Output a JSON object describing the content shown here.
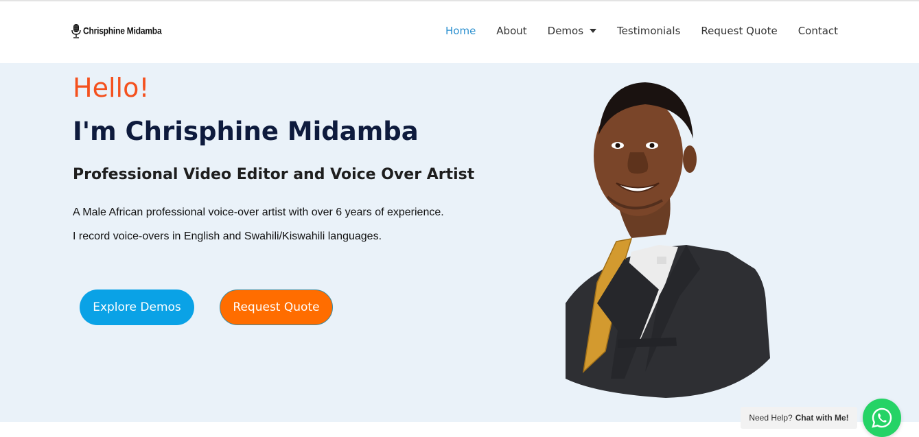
{
  "brand": {
    "name": "Chrisphine Midamba"
  },
  "nav": {
    "items": [
      {
        "label": "Home",
        "active": true
      },
      {
        "label": "About"
      },
      {
        "label": "Demos",
        "has_dropdown": true
      },
      {
        "label": "Testimonials"
      },
      {
        "label": "Request Quote"
      },
      {
        "label": "Contact"
      }
    ]
  },
  "hero": {
    "greeting": "Hello!",
    "title": "I'm Chrisphine Midamba",
    "subtitle": "Professional Video Editor and Voice Over Artist",
    "description": [
      "A Male African professional voice-over artist with over 6 years of experience.",
      "I record voice-overs in English and Swahili/Kiswahili languages."
    ],
    "buttons": {
      "explore": "Explore Demos",
      "quote": "Request Quote"
    }
  },
  "chat": {
    "prefix": "Need Help?",
    "cta": "Chat with Me!",
    "icon": "whatsapp-icon"
  },
  "colors": {
    "accent_orange": "#f4511e",
    "nav_active": "#2a8fcf",
    "explore_button": "#0aa2e6",
    "quote_button": "#ff6d00",
    "hero_bg": "#eaf2f9",
    "whatsapp": "#25d366",
    "title": "#0e1b3d"
  }
}
